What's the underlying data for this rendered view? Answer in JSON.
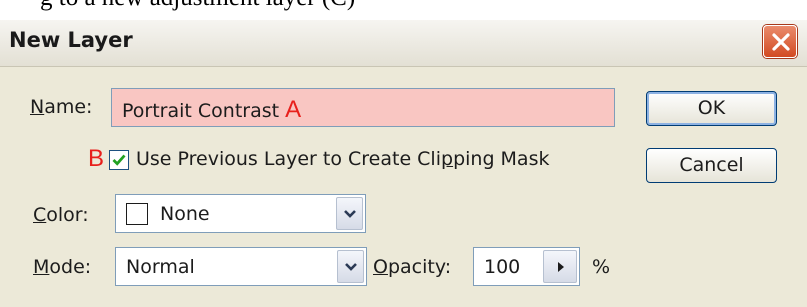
{
  "caption": "g to a new adjustment layer (C)",
  "dialog": {
    "title": "New Layer",
    "ok_label": "OK",
    "cancel_label": "Cancel"
  },
  "name_field": {
    "label_accel": "N",
    "label_rest": "ame:",
    "value": "Portrait Contrast",
    "marker": "A"
  },
  "clipping": {
    "marker": "B",
    "checked": true,
    "label_pre": "Use Previous Layer to Create Cli",
    "label_accel": "p",
    "label_post": "ping Mask"
  },
  "color_field": {
    "label_accel": "C",
    "label_rest": "olor:",
    "value": "None"
  },
  "mode_field": {
    "label_accel": "M",
    "label_rest": "ode:",
    "value": "Normal"
  },
  "opacity_field": {
    "label_accel": "O",
    "label_rest": "pacity:",
    "value": "100",
    "unit": "%"
  },
  "colors": {
    "name_highlight": "#f9c6c2",
    "marker": "#e8201c",
    "dialog_bg": "#ece9d8",
    "close_button": "#d24a22"
  },
  "icons": {
    "close": "close-x-icon",
    "dropdown": "chevron-down-icon",
    "stepper": "arrow-right-icon",
    "checkbox": "checkmark-icon"
  }
}
